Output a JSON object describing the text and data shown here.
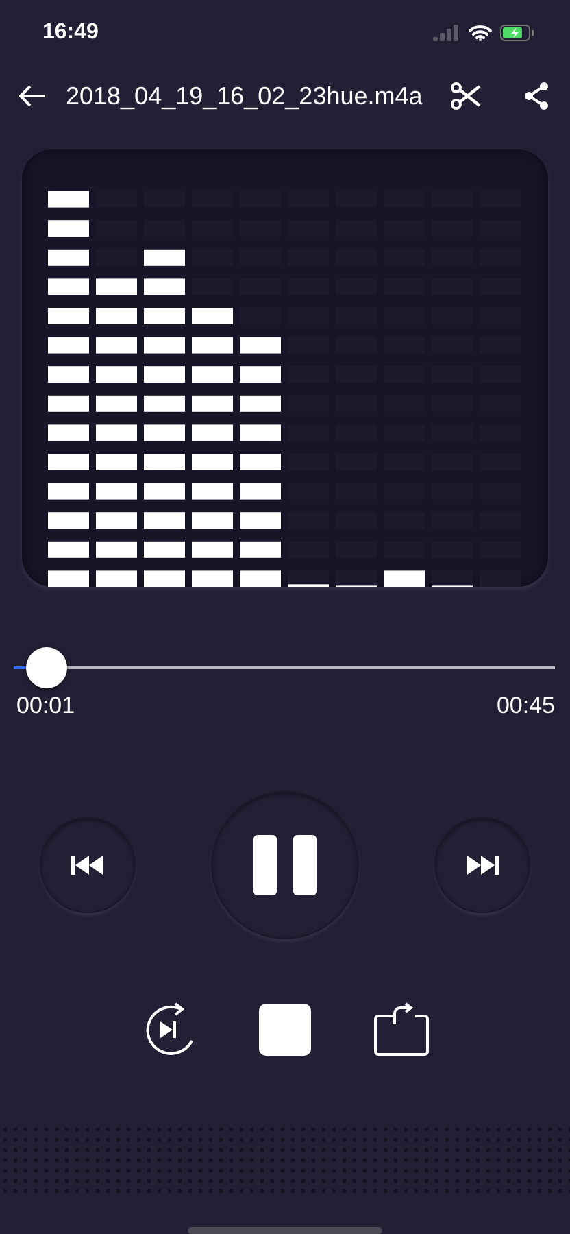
{
  "status_bar": {
    "time": "16:49"
  },
  "header": {
    "title": "2018_04_19_16_02_23hue.m4a"
  },
  "progress": {
    "level": 0.06,
    "elapsed": "00:01",
    "total": "00:45"
  },
  "playback": {
    "playing": true
  }
}
